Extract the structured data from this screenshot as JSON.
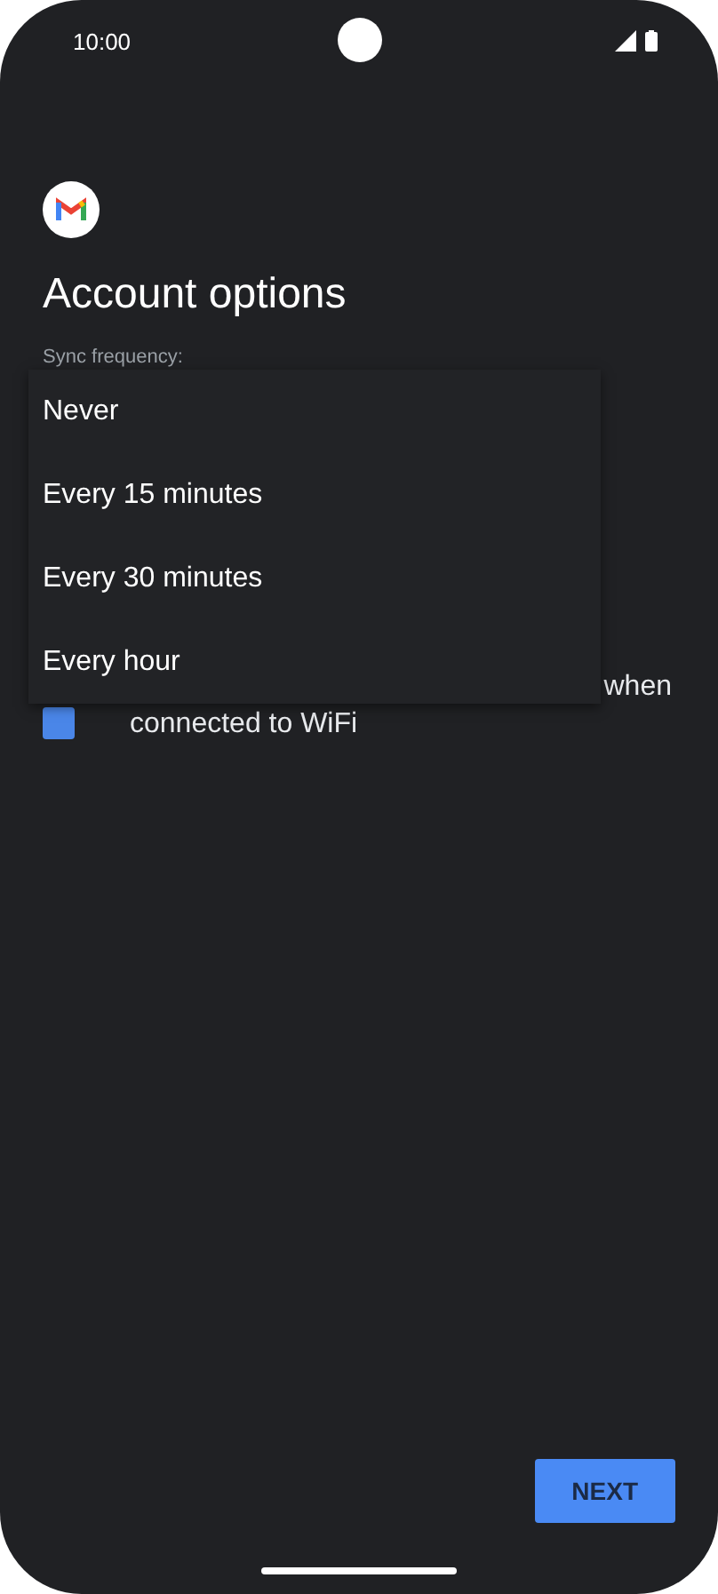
{
  "status_bar": {
    "time": "10:00"
  },
  "title": "Account options",
  "sync": {
    "label": "Sync frequency:",
    "menu_open": true,
    "options": [
      "Never",
      "Every 15 minutes",
      "Every 30 minutes",
      "Every hour"
    ]
  },
  "download_option": {
    "checked": true,
    "label_line_1": "when",
    "label_line_2": "connected to WiFi"
  },
  "buttons": [
    {
      "label": "NEXT",
      "kind": "primary"
    }
  ]
}
